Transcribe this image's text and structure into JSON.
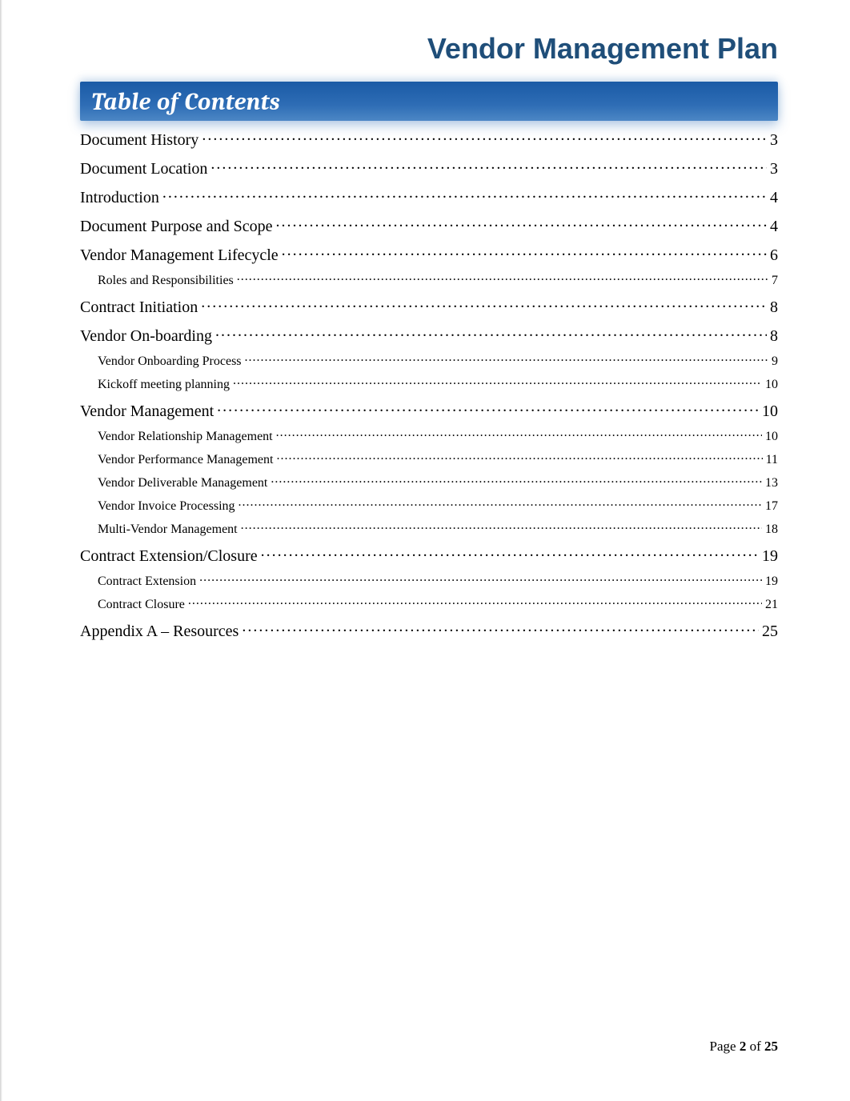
{
  "document_title": "Vendor Management Plan",
  "toc_title": "Table of Contents",
  "toc": [
    {
      "level": 1,
      "label": "Document History",
      "page": "3"
    },
    {
      "level": 1,
      "label": "Document Location",
      "page": "3"
    },
    {
      "level": 1,
      "label": "Introduction",
      "page": "4"
    },
    {
      "level": 1,
      "label": "Document Purpose and Scope",
      "page": "4"
    },
    {
      "level": 1,
      "label": "Vendor Management Lifecycle",
      "page": "6"
    },
    {
      "level": 2,
      "label": "Roles and Responsibilities",
      "page": "7"
    },
    {
      "level": 1,
      "label": "Contract Initiation",
      "page": "8"
    },
    {
      "level": 1,
      "label": "Vendor On-boarding",
      "page": "8"
    },
    {
      "level": 2,
      "label": "Vendor Onboarding Process",
      "page": "9"
    },
    {
      "level": 2,
      "label": "Kickoff meeting planning",
      "page": "10"
    },
    {
      "level": 1,
      "label": "Vendor Management",
      "page": "10"
    },
    {
      "level": 2,
      "label": "Vendor Relationship Management",
      "page": "10"
    },
    {
      "level": 2,
      "label": "Vendor Performance Management",
      "page": "11"
    },
    {
      "level": 2,
      "label": "Vendor Deliverable Management",
      "page": "13"
    },
    {
      "level": 2,
      "label": "Vendor Invoice Processing",
      "page": "17"
    },
    {
      "level": 2,
      "label": "Multi-Vendor Management",
      "page": "18"
    },
    {
      "level": 1,
      "label": "Contract Extension/Closure",
      "page": "19"
    },
    {
      "level": 2,
      "label": "Contract Extension",
      "page": "19"
    },
    {
      "level": 2,
      "label": "Contract Closure",
      "page": "21"
    },
    {
      "level": 1,
      "label": "Appendix A – Resources",
      "page": "25"
    }
  ],
  "footer": {
    "prefix": "Page ",
    "current": "2",
    "separator": " of ",
    "total": "25"
  }
}
